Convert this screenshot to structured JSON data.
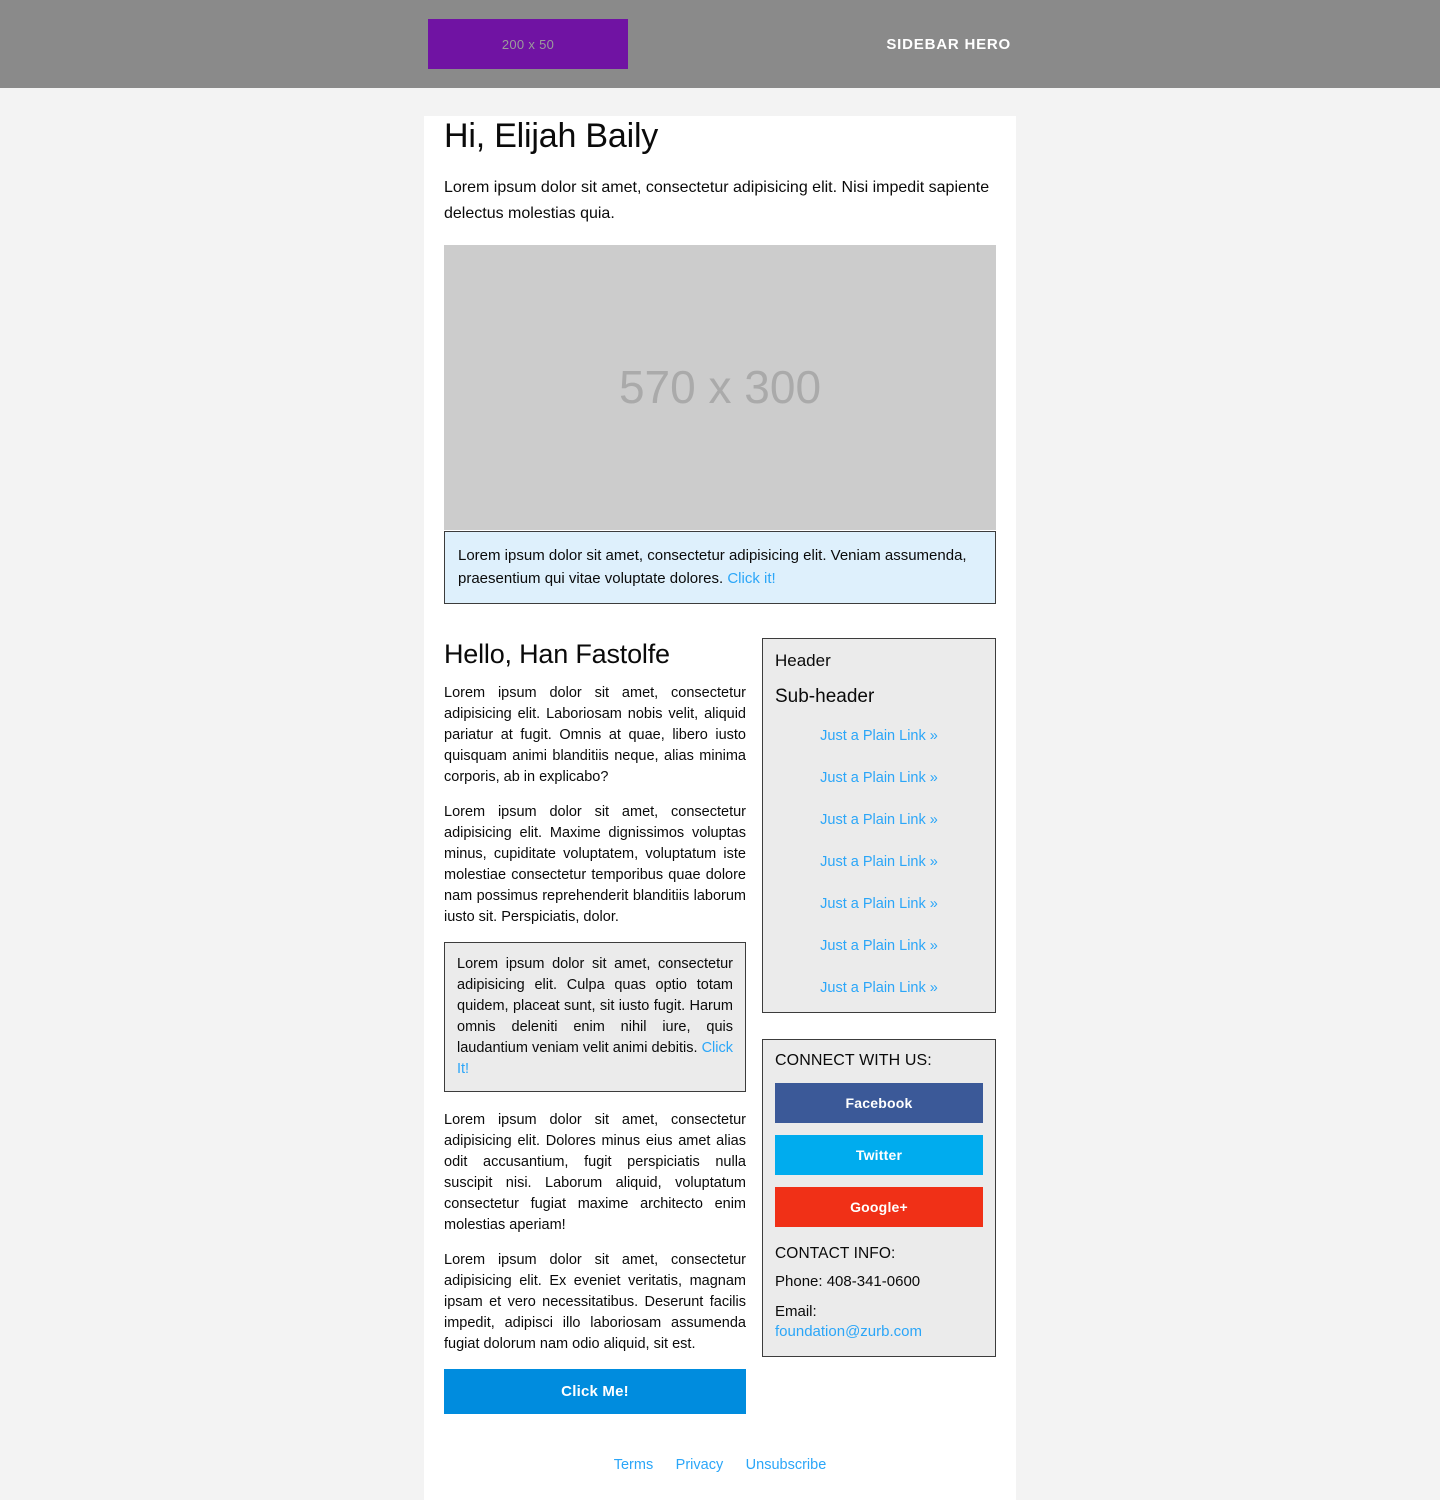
{
  "hero": {
    "logo_placeholder_label": "200 x 50",
    "logo_color": "#7013a3",
    "title": "SIDEBAR HERO",
    "bar_color": "#8a8a8a"
  },
  "main": {
    "greeting": "Hi, Elijah Baily",
    "lede": "Lorem ipsum dolor sit amet, consectetur adipisicing elit. Nisi impedit sapiente delectus molestias quia.",
    "image_placeholder_label": "570 x 300",
    "callout": {
      "text": "Lorem ipsum dolor sit amet, consectetur adipisicing elit. Veniam assumenda, praesentium qui vitae voluptate dolores. ",
      "link_label": "Click it!",
      "background": "#def0fc"
    }
  },
  "article": {
    "heading": "Hello, Han Fastolfe",
    "paragraph_1": "Lorem ipsum dolor sit amet, consectetur adipisicing elit. Laboriosam nobis velit, aliquid pariatur at fugit. Omnis at quae, libero iusto quisquam animi blanditiis neque, alias minima corporis, ab in explicabo?",
    "paragraph_2": "Lorem ipsum dolor sit amet, consectetur adipisicing elit. Maxime dignissimos voluptas minus, cupiditate voluptatem, voluptatum iste molestiae consectetur temporibus quae dolore nam possimus reprehenderit blanditiis laborum iusto sit. Perspiciatis, dolor.",
    "panel": {
      "text": "Lorem ipsum dolor sit amet, consectetur adipisicing elit. Culpa quas optio totam quidem, placeat sunt, sit iusto fugit. Harum omnis deleniti enim nihil iure, quis laudantium veniam velit animi debitis. ",
      "link_label": "Click It!"
    },
    "paragraph_3": "Lorem ipsum dolor sit amet, consectetur adipisicing elit. Dolores minus eius amet alias odit accusantium, fugit perspiciatis nulla suscipit nisi. Laborum aliquid, voluptatum consectetur fugiat maxime architecto enim molestias aperiam!",
    "paragraph_4": "Lorem ipsum dolor sit amet, consectetur adipisicing elit. Ex eveniet veritatis, magnam ipsam et vero necessitatibus. Deserunt facilis impedit, adipisci illo laboriosam assumenda fugiat dolorum nam odio aliquid, sit est.",
    "cta_label": "Click Me!"
  },
  "sidebar": {
    "header": "Header",
    "sub_header": "Sub-header",
    "links": [
      "Just a Plain Link »",
      "Just a Plain Link »",
      "Just a Plain Link »",
      "Just a Plain Link »",
      "Just a Plain Link »",
      "Just a Plain Link »",
      "Just a Plain Link »"
    ],
    "connect_title": "CONNECT WITH US:",
    "social": [
      {
        "label": "Facebook",
        "color": "#3b5998"
      },
      {
        "label": "Twitter",
        "color": "#00acee"
      },
      {
        "label": "Google+",
        "color": "#f03017"
      }
    ],
    "contact_title": "CONTACT INFO:",
    "phone": "Phone: 408-341-0600",
    "email_label": "Email:",
    "email": "foundation@zurb.com"
  },
  "footer": {
    "links": [
      "Terms",
      "Privacy",
      "Unsubscribe"
    ]
  },
  "colors": {
    "link": "#2ba6f8",
    "button": "#008cde",
    "page_bg": "#f3f3f3",
    "panel_bg": "#ebebeb"
  }
}
